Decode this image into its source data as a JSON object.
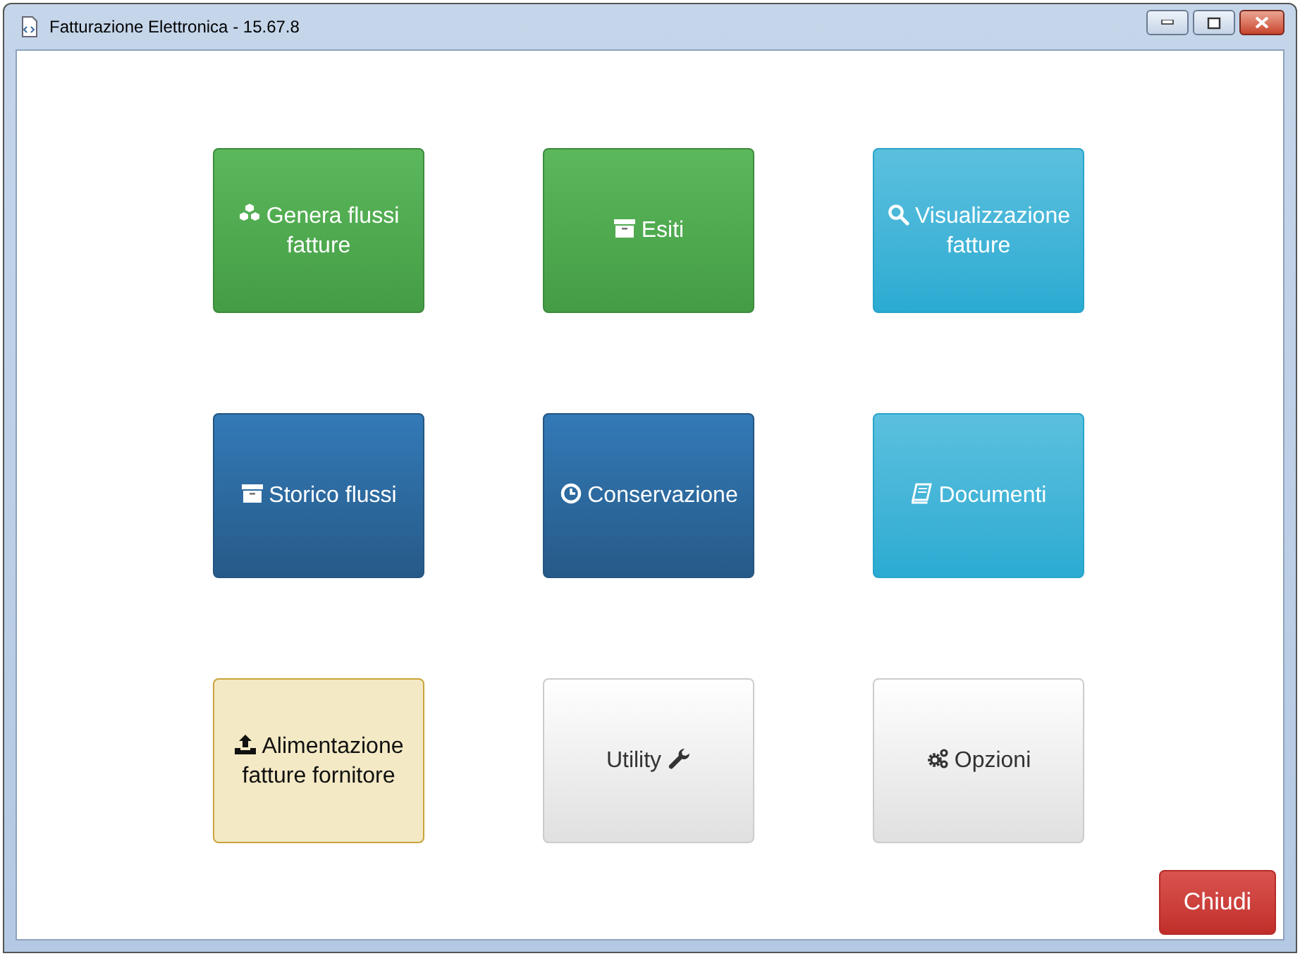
{
  "window": {
    "title": "Fatturazione Elettronica - 15.67.8"
  },
  "tiles": [
    {
      "label": "Genera flussi fatture"
    },
    {
      "label": "Esiti"
    },
    {
      "label": "Visualizzazione fatture"
    },
    {
      "label": "Storico flussi"
    },
    {
      "label": "Conservazione"
    },
    {
      "label": "Documenti"
    },
    {
      "label": "Alimentazione fatture fornitore"
    },
    {
      "label": "Utility"
    },
    {
      "label": "Opzioni"
    }
  ],
  "close_button": {
    "label": "Chiudi"
  }
}
